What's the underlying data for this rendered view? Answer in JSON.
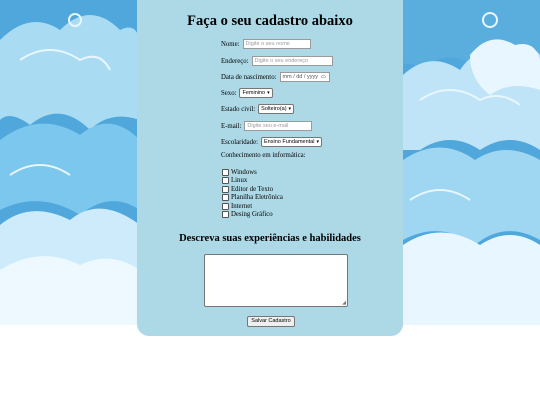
{
  "colors": {
    "panel": "#add8e6",
    "sky": "#3d9bd4",
    "cloud": "#e8f7ff"
  },
  "form": {
    "title": "Faça o seu cadastro abaixo",
    "nome_label": "Nome:",
    "nome_placeholder": "Digite o seu nome",
    "endereco_label": "Endereço:",
    "endereco_placeholder": "Digite o seu endereço",
    "nascimento_label": "Data de nascimento:",
    "nascimento_placeholder": "mm / dd / yyyy",
    "sexo_label": "Sexo:",
    "sexo_value": "Feminino",
    "estado_label": "Estado civil:",
    "estado_value": "Solteiro(a)",
    "email_label": "E-mail:",
    "email_placeholder": "Digite seu e-mail",
    "escolaridade_label": "Escolaridade:",
    "escolaridade_value": "Ensino Fundamental",
    "conhecimento_label": "Conhecimento em informática:",
    "checkboxes": [
      "Windows",
      "Linux",
      "Editor de Texto",
      "Planilha Eletrônica",
      "Internet",
      "Desing Gráfico"
    ],
    "subtitle": "Descreva suas experiências e habilidades",
    "submit_label": "Salvar Cadastro"
  }
}
